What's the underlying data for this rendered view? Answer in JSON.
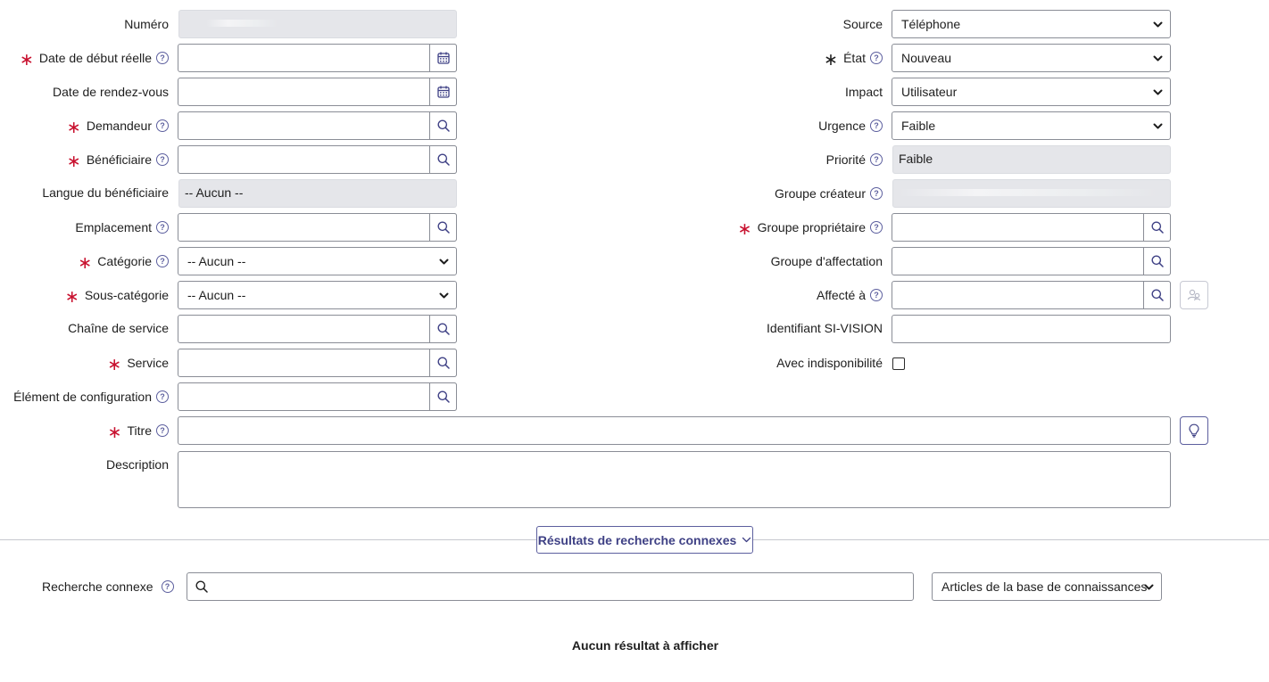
{
  "left": {
    "numero": {
      "label": "Numéro",
      "value": ""
    },
    "date_debut": {
      "label": "Date de début réelle",
      "value": ""
    },
    "date_rdv": {
      "label": "Date de rendez-vous",
      "value": ""
    },
    "demandeur": {
      "label": "Demandeur",
      "value": ""
    },
    "beneficiaire": {
      "label": "Bénéficiaire",
      "value": ""
    },
    "langue": {
      "label": "Langue du bénéficiaire",
      "value": "-- Aucun --"
    },
    "emplacement": {
      "label": "Emplacement",
      "value": ""
    },
    "categorie": {
      "label": "Catégorie",
      "value": "-- Aucun --"
    },
    "sous_categorie": {
      "label": "Sous-catégorie",
      "value": "-- Aucun --"
    },
    "chaine_service": {
      "label": "Chaîne de service",
      "value": ""
    },
    "service": {
      "label": "Service",
      "value": ""
    },
    "element_config": {
      "label": "Élément de configuration",
      "value": ""
    }
  },
  "right": {
    "source": {
      "label": "Source",
      "value": "Téléphone"
    },
    "etat": {
      "label": "État",
      "value": "Nouveau"
    },
    "impact": {
      "label": "Impact",
      "value": "Utilisateur"
    },
    "urgence": {
      "label": "Urgence",
      "value": "Faible"
    },
    "priorite": {
      "label": "Priorité",
      "value": "Faible"
    },
    "groupe_createur": {
      "label": "Groupe créateur",
      "value": ""
    },
    "groupe_proprietaire": {
      "label": "Groupe propriétaire",
      "value": ""
    },
    "groupe_affectation": {
      "label": "Groupe d'affectation",
      "value": ""
    },
    "affecte_a": {
      "label": "Affecté à",
      "value": ""
    },
    "identifiant": {
      "label": "Identifiant SI-VISION",
      "value": ""
    },
    "indisponibilite": {
      "label": "Avec indisponibilité",
      "checked": false
    }
  },
  "titre": {
    "label": "Titre",
    "value": ""
  },
  "description": {
    "label": "Description",
    "value": ""
  },
  "related": {
    "toggle_label": "Résultats de recherche connexes",
    "search_label": "Recherche connexe",
    "search_value": "",
    "source_select": "Articles de la base de connaissances",
    "empty_message": "Aucun résultat à afficher"
  },
  "colors": {
    "required": "#c8102e",
    "accent": "#5c5f9e",
    "readonly_bg": "#e5e6ea"
  }
}
